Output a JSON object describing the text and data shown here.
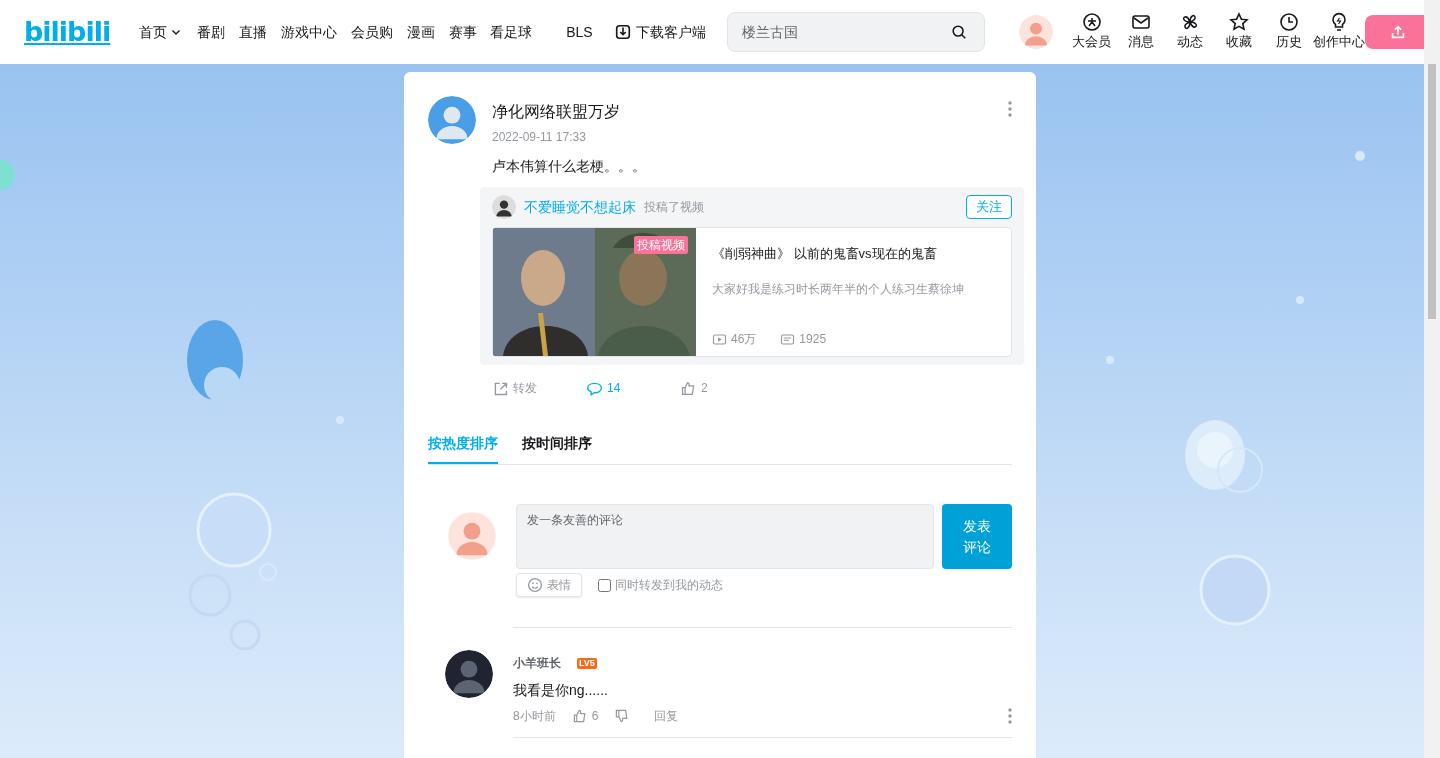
{
  "header": {
    "logo": "bilibili",
    "nav": [
      {
        "label": "首页",
        "kind": "dropdown"
      },
      {
        "label": "番剧",
        "kind": "link"
      },
      {
        "label": "直播",
        "kind": "link"
      },
      {
        "label": "游戏中心",
        "kind": "link"
      },
      {
        "label": "会员购",
        "kind": "link"
      },
      {
        "label": "漫画",
        "kind": "link"
      },
      {
        "label": "赛事",
        "kind": "link"
      },
      {
        "label": "看足球",
        "kind": "link"
      },
      {
        "label": "BLS",
        "kind": "link"
      },
      {
        "label": "下载客户端",
        "kind": "download"
      }
    ],
    "search": {
      "placeholder": "楼兰古国"
    },
    "actions": [
      {
        "label": "大会员",
        "kind": "vip"
      },
      {
        "label": "消息",
        "kind": "mail"
      },
      {
        "label": "动态",
        "kind": "fan"
      },
      {
        "label": "收藏",
        "kind": "star"
      },
      {
        "label": "历史",
        "kind": "clock"
      },
      {
        "label": "创作中心",
        "kind": "bulb"
      }
    ]
  },
  "post": {
    "author": "净化网络联盟万岁",
    "time": "2022-09-11 17:33",
    "text": "卢本伟算什么老梗。。。",
    "repost": {
      "user": "不爱睡觉不想起床",
      "action": "投稿了视频",
      "follow": "关注",
      "video": {
        "badge": "投稿视频",
        "title": "《削弱神曲》 以前的鬼畜vs现在的鬼畜",
        "description": "大家好我是练习时长两年半的个人练习生蔡徐坤",
        "views": "46万",
        "danmaku": "1925"
      }
    },
    "actions": [
      {
        "label": "转发",
        "kind": "share",
        "active": false
      },
      {
        "label": "14",
        "kind": "comment",
        "active": true
      },
      {
        "label": "2",
        "kind": "like",
        "active": false
      }
    ]
  },
  "sort_tabs": [
    {
      "label": "按热度排序",
      "selected": true
    },
    {
      "label": "按时间排序",
      "selected": false
    }
  ],
  "composer": {
    "placeholder": "发一条友善的评论",
    "submit": "发表评论",
    "emoji": "表情",
    "also_repost": {
      "label": "同时转发到我的动态",
      "checked": false
    }
  },
  "comments": [
    {
      "user": "小羊班长",
      "level": "LV5",
      "text": "我看是你ng......",
      "time": "8小时前",
      "likes": "6",
      "reply": "回复"
    }
  ]
}
